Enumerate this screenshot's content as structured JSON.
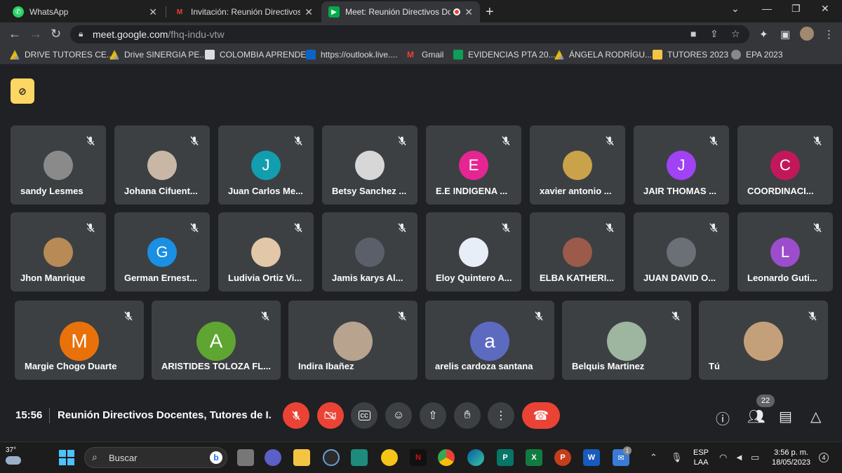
{
  "browser": {
    "tabs": [
      {
        "title": "WhatsApp",
        "icon": "whatsapp-icon",
        "color": "#25d366"
      },
      {
        "title": "Invitación: Reunión Directivos Do",
        "icon": "gmail-icon",
        "color": "#ea4335"
      },
      {
        "title": "Meet: Reunión Directivos Do",
        "icon": "meet-icon",
        "color": "#00ac47"
      }
    ],
    "url_host": "meet.google.com",
    "url_path": "/fhq-indu-vtw",
    "bookmarks": [
      {
        "label": "DRIVE TUTORES CE...",
        "icon": "drive-icon"
      },
      {
        "label": "Drive SINERGIA PE...",
        "icon": "drive-icon"
      },
      {
        "label": "COLOMBIA APRENDE",
        "icon": "page-icon"
      },
      {
        "label": "https://outlook.live....",
        "icon": "outlook-icon"
      },
      {
        "label": "Gmail",
        "icon": "gmail-icon"
      },
      {
        "label": "EVIDENCIAS PTA 20...",
        "icon": "sheets-icon"
      },
      {
        "label": "ÁNGELA RODRÍGU...",
        "icon": "drive-icon"
      },
      {
        "label": "TUTORES 2023",
        "icon": "folder-icon"
      },
      {
        "label": "EPA 2023",
        "icon": "globe-icon"
      }
    ]
  },
  "meet": {
    "participants_row1": [
      {
        "name": "sandy Lesmes",
        "initial": "",
        "color": "#8a8a8a"
      },
      {
        "name": "Johana Cifuent...",
        "initial": "",
        "color": "#c9b7a6"
      },
      {
        "name": "Juan Carlos Me...",
        "initial": "J",
        "color": "#129eaf"
      },
      {
        "name": "Betsy Sanchez ...",
        "initial": "",
        "color": "#d7d7d7"
      },
      {
        "name": "E.E INDIGENA ...",
        "initial": "E",
        "color": "#e52592"
      },
      {
        "name": "xavier antonio ...",
        "initial": "",
        "color": "#c9a24a"
      },
      {
        "name": "JAIR THOMAS ...",
        "initial": "J",
        "color": "#a142f4"
      },
      {
        "name": "COORDINACI...",
        "initial": "C",
        "color": "#c2185b"
      }
    ],
    "participants_row2": [
      {
        "name": "Jhon Manrique",
        "initial": "",
        "color": "#b88a55"
      },
      {
        "name": "German Ernest...",
        "initial": "G",
        "color": "#1a8fe3"
      },
      {
        "name": "Ludivia Ortiz Vi...",
        "initial": "",
        "color": "#e2c7a8"
      },
      {
        "name": "Jamis karys Al...",
        "initial": "",
        "color": "#5a5f6a"
      },
      {
        "name": "Eloy Quintero A...",
        "initial": "",
        "color": "#e8eef8"
      },
      {
        "name": "ELBA KATHERI...",
        "initial": "",
        "color": "#9b5a4a"
      },
      {
        "name": "JUAN DAVID O...",
        "initial": "",
        "color": "#6b7077"
      },
      {
        "name": "Leonardo Guti...",
        "initial": "L",
        "color": "#9c4dcc"
      }
    ],
    "participants_row3": [
      {
        "name": "Margie Chogo Duarte",
        "initial": "M",
        "color": "#e8710a"
      },
      {
        "name": "ARISTIDES TOLOZA FL...",
        "initial": "A",
        "color": "#5ea531"
      },
      {
        "name": "Indira Ibañez",
        "initial": "",
        "color": "#b7a38e"
      },
      {
        "name": "arelis cardoza santana",
        "initial": "a",
        "color": "#5c6bc0"
      },
      {
        "name": "Belquis Martinez",
        "initial": "",
        "color": "#9eb5a0"
      },
      {
        "name": "Tú",
        "initial": "",
        "color": "#c4a07a"
      }
    ],
    "time": "15:56",
    "meeting_name": "Reunión Directivos Docentes, Tutores de I...",
    "participant_count": "22"
  },
  "taskbar": {
    "temperature": "37°",
    "search_label": "Buscar",
    "lang_line1": "ESP",
    "lang_line2": "LAA",
    "clock_time": "3:56 p. m.",
    "clock_date": "18/05/2023",
    "notif_count": "4",
    "mail_badge": "1"
  }
}
